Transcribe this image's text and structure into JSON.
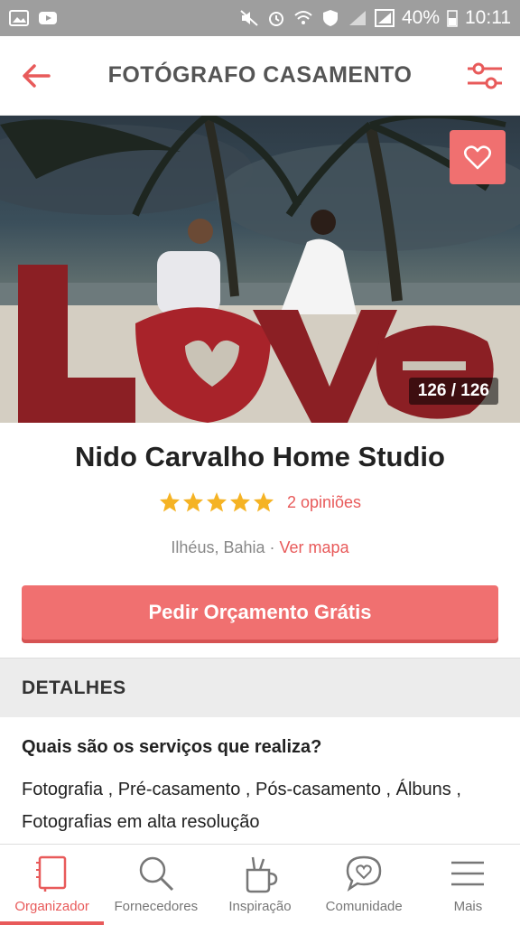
{
  "status_bar": {
    "battery": "40%",
    "time": "10:11"
  },
  "app_bar": {
    "title": "FOTÓGRAFO CASAMENTO"
  },
  "hero": {
    "counter": "126 / 126"
  },
  "vendor": {
    "name": "Nido Carvalho Home Studio",
    "rating": 5,
    "reviews": "2 opiniões",
    "location": "Ilhéus, Bahia",
    "separator": "·",
    "map_link": "Ver mapa"
  },
  "cta": {
    "label": "Pedir Orçamento Grátis"
  },
  "details": {
    "header": "DETALHES",
    "question": "Quais são os serviços que realiza?",
    "answer": "Fotografia , Pré-casamento , Pós-casamento , Álbuns , Fotografias em alta resolução"
  },
  "bottom_nav": {
    "items": [
      {
        "label": "Organizador",
        "icon": "notebook-icon",
        "active": true
      },
      {
        "label": "Fornecedores",
        "icon": "search-icon",
        "active": false
      },
      {
        "label": "Inspiração",
        "icon": "brush-cup-icon",
        "active": false
      },
      {
        "label": "Comunidade",
        "icon": "chat-heart-icon",
        "active": false
      },
      {
        "label": "Mais",
        "icon": "menu-icon",
        "active": false
      }
    ]
  },
  "colors": {
    "accent": "#f07070",
    "link": "#e85a5a",
    "star": "#f5b324",
    "status_bar": "#9e9e9e"
  }
}
